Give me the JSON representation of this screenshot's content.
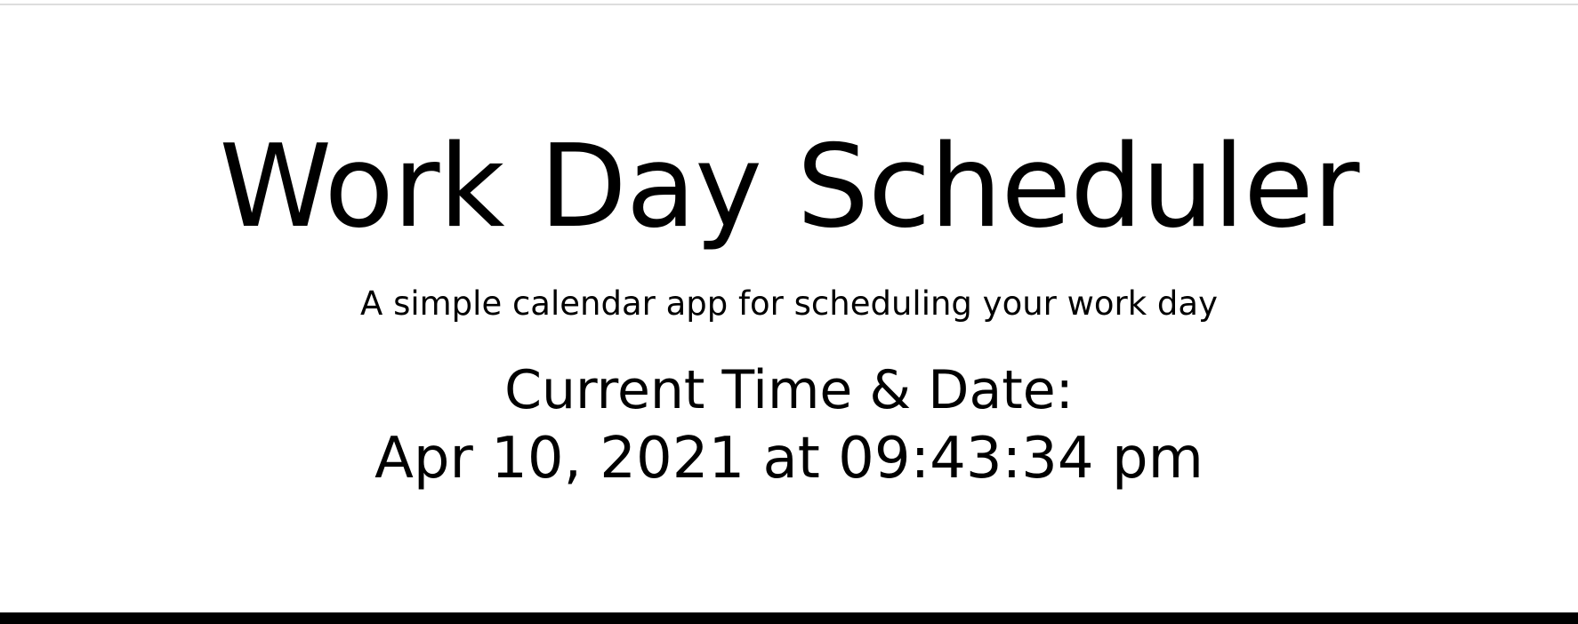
{
  "header": {
    "title": "Work Day Scheduler",
    "subtitle": "A simple calendar app for scheduling your work day",
    "clock_label": "Current Time & Date:",
    "clock_value": "Apr 10, 2021 at 09:43:34 pm"
  },
  "colors": {
    "background": "#ffffff",
    "text": "#000000",
    "divider": "#dddddd",
    "bottom_bar": "#000000"
  }
}
